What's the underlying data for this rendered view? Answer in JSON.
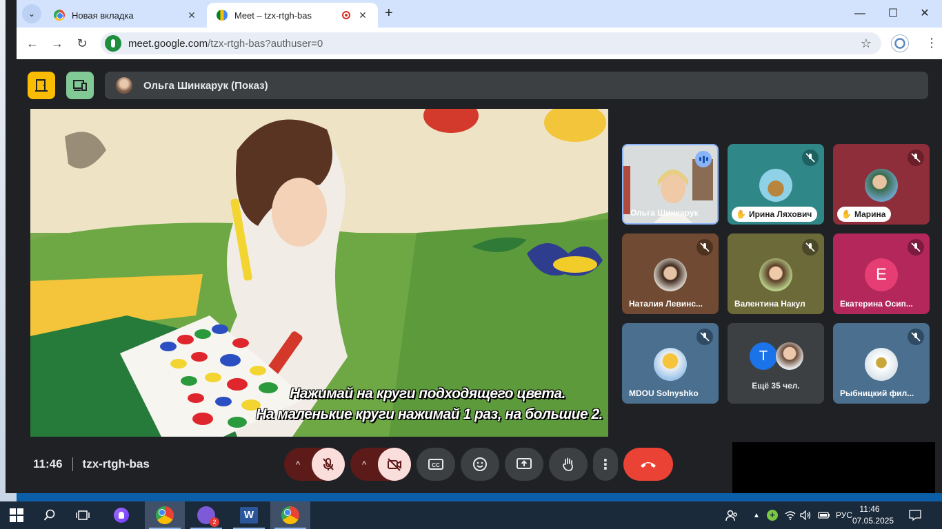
{
  "browser": {
    "tabs": [
      {
        "title": "Новая вкладка"
      },
      {
        "title": "Meet – tzx-rtgh-bas"
      }
    ],
    "url_host": "meet.google.com",
    "url_path": "/tzx-rtgh-bas?authuser=0"
  },
  "meet": {
    "presenter": "Ольга Шинкарук (Показ)",
    "subtitle_line1": "Нажимай на круги подходящего цвета.",
    "subtitle_line2": "На маленькие круги нажимай 1 раз, на большие 2.",
    "participants": [
      {
        "name": "Ольга Шинкарук",
        "speaking": true
      },
      {
        "name": "Ирина Ляхович",
        "muted": true,
        "hand": true
      },
      {
        "name": "Марина",
        "muted": true,
        "hand": true
      },
      {
        "name": "Наталия Левинс...",
        "muted": true
      },
      {
        "name": "Валентина Накул",
        "muted": true
      },
      {
        "name": "Екатерина Осип...",
        "muted": true,
        "initial": "Е"
      },
      {
        "name": "MDOU Solnyshko",
        "muted": true
      },
      {
        "name": "Ещё 35 чел.",
        "initial": "T"
      },
      {
        "name": "Рыбницкий фил...",
        "muted": true
      }
    ],
    "time": "11:46",
    "meeting_code": "tzx-rtgh-bas",
    "colors": {
      "end_call": "#ea4335",
      "mic_bg": "#f9dedc",
      "mic_group": "#5c1a19"
    }
  },
  "taskbar": {
    "viber_badge": "2",
    "language": "РУС",
    "time": "11:46",
    "date": "07.05.2025"
  }
}
